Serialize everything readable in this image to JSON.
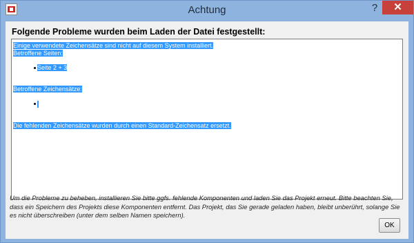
{
  "window": {
    "title": "Achtung",
    "help_label": "?",
    "close_label": "✕"
  },
  "dialog": {
    "headline": "Folgende Probleme wurden beim Laden der Datei festgestellt:",
    "report": {
      "line1": "Einige verwendete Zeichensätze sind nicht auf diesem System installiert.",
      "affected_pages_label": "Betroffene Seiten:",
      "affected_pages": [
        "Seite 2 + 3"
      ],
      "affected_fonts_label": "Betroffene Zeichensätze:",
      "affected_fonts": [
        ""
      ],
      "conclusion": "Die fehlenden Zeichensätze wurden durch einen Standard-Zeichensatz ersetzt."
    },
    "info": "Um die Probleme zu beheben, installieren Sie bitte ggfs. fehlende Komponenten und laden Sie das Projekt erneut. Bitte beachten Sie, dass ein Speichern des Projekts diese Komponenten entfernt. Das Projekt, das Sie gerade geladen haben, bleibt unberührt, solange Sie es nicht überschreiben (unter dem selben Namen speichern).",
    "ok_label": "OK"
  },
  "colors": {
    "selection": "#3399ff",
    "close_button": "#c7403a",
    "title_bar": "#8fb3df"
  }
}
